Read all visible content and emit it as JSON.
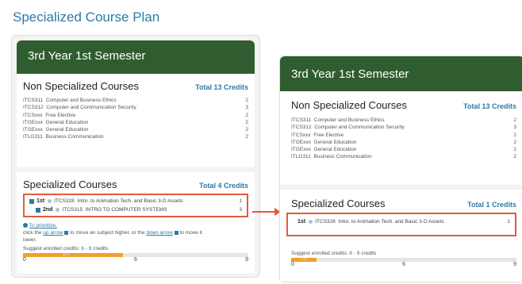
{
  "page_title": "Specialized Course Plan",
  "colors": {
    "header_green": "#2f5d2f",
    "link_blue": "#2d7aa5",
    "highlight_red": "#e45a3c",
    "progress_orange": "#f0a030"
  },
  "left_panel": {
    "semester_title": "3rd Year 1st Semester",
    "non_specialized": {
      "title": "Non Specialized Courses",
      "total_credits": "Total 13 Credits",
      "courses": [
        {
          "code": "ITCS311",
          "name": "Computer and Business Ethics",
          "credits": "2"
        },
        {
          "code": "ITCS312",
          "name": "Computer and Communication Security",
          "credits": "3"
        },
        {
          "code": "ITCSxxx",
          "name": "Free Elective",
          "credits": "2"
        },
        {
          "code": "ITGExxx",
          "name": "General Education",
          "credits": "2"
        },
        {
          "code": "ITGExxx",
          "name": "General Education",
          "credits": "2"
        },
        {
          "code": "ITLG311",
          "name": "Business Communication",
          "credits": "2"
        }
      ]
    },
    "specialized": {
      "title": "Specialized Courses",
      "total_credits": "Total 4 Credits",
      "selected": [
        {
          "rank": "1st",
          "code": "ITCS328",
          "name": "Intro. to Animation Tech. and Basic 3-D Assets",
          "credits": "1"
        },
        {
          "rank": "2nd",
          "code": "ITCS315",
          "name": "INTRO TO COMPUTER SYSTEMS",
          "credits": "3"
        }
      ]
    },
    "prioritize": {
      "link": "To prioritize,",
      "line1_pre": "click the",
      "up_arrow": "up arrow",
      "line1_mid": "to move an subject higher, or the",
      "down_arrow": "down arrow",
      "line1_post": "to move it",
      "line2": "lower."
    },
    "suggest": {
      "label": "Suggest enrolled credits:",
      "range": "6 - 9",
      "unit": "credits"
    },
    "progress": {
      "value": 4,
      "max": 9,
      "fill_label": "4 Cr"
    },
    "scale": [
      "0",
      "6",
      "9"
    ]
  },
  "right_panel": {
    "semester_title": "3rd Year 1st Semester",
    "non_specialized": {
      "title": "Non Specialized Courses",
      "total_credits": "Total 13 Credits",
      "courses": [
        {
          "code": "ITCS311",
          "name": "Computer and Business Ethics",
          "credits": "2"
        },
        {
          "code": "ITCS312",
          "name": "Computer and Communication Security",
          "credits": "3"
        },
        {
          "code": "ITCSxxx",
          "name": "Free Elective",
          "credits": "2"
        },
        {
          "code": "ITGExxx",
          "name": "General Education",
          "credits": "2"
        },
        {
          "code": "ITGExxx",
          "name": "General Education",
          "credits": "2"
        },
        {
          "code": "ITLG311",
          "name": "Business Communication",
          "credits": "2"
        }
      ]
    },
    "specialized": {
      "title": "Specialized Courses",
      "total_credits": "Total 1 Credits",
      "selected": [
        {
          "rank": "1st",
          "code": "ITCS328",
          "name": "Intro. to Animation Tech. and Basic 3-D Assets",
          "credits": "1"
        }
      ]
    },
    "suggest": {
      "label": "Suggest enrolled credits:",
      "range": "6 - 9",
      "unit": "credits"
    },
    "progress": {
      "value": 1,
      "max": 9,
      "fill_label": "1 Cr"
    },
    "scale": [
      "0",
      "6",
      "9"
    ]
  }
}
